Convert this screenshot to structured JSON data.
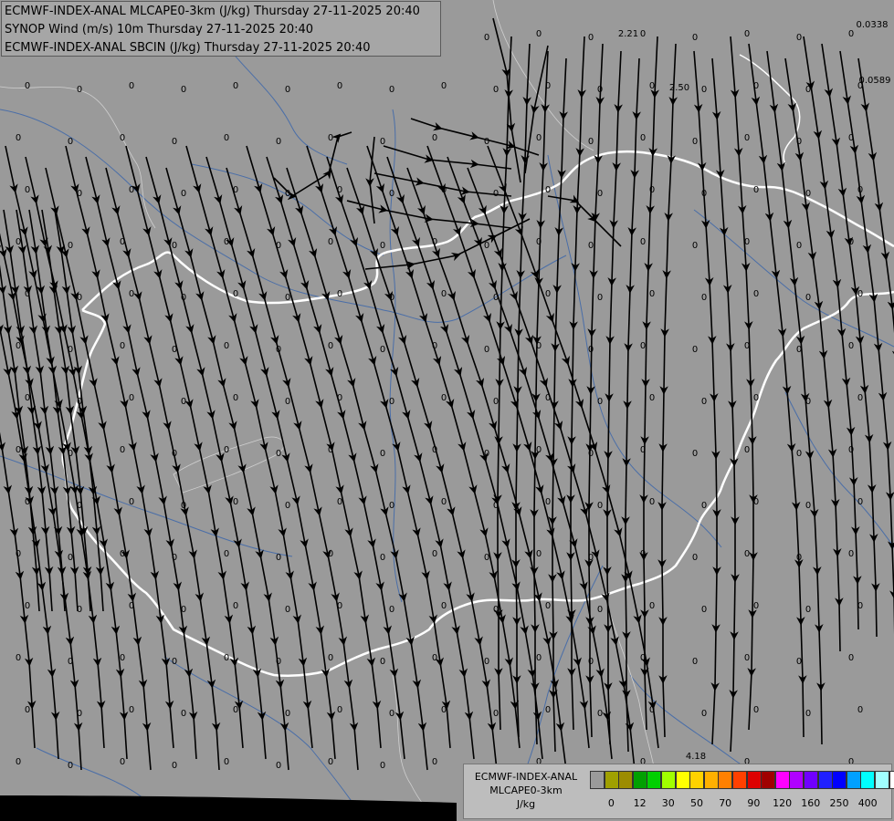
{
  "titles": [
    "ECMWF-INDEX-ANAL MLCAPE0-3km (J/kg) Thursday 27-11-2025 20:40",
    "SYNOP Wind (m/s) 10m Thursday 27-11-2025 20:40",
    "ECMWF-INDEX-ANAL SBCIN (J/kg) Thursday 27-11-2025 20:40"
  ],
  "legend": {
    "caption": [
      "ECMWF-INDEX-ANAL",
      "MLCAPE0-3km",
      "J/kg"
    ],
    "colors": [
      "#9a9a9a",
      "#a0a000",
      "#9c8c00",
      "#00a000",
      "#00d000",
      "#a0ff00",
      "#ffff00",
      "#ffd200",
      "#ffb000",
      "#ff8000",
      "#ff4000",
      "#dd0000",
      "#a00000",
      "#ff00ff",
      "#b000ff",
      "#7000ff",
      "#2020ff",
      "#0000ff",
      "#00a0ff",
      "#00ffff",
      "#a0ffff",
      "#ffffff"
    ],
    "ticks": [
      "0",
      "12",
      "30",
      "50",
      "70",
      "90",
      "120",
      "160",
      "250",
      "400"
    ]
  },
  "cape_values": {
    "grid_label": "0",
    "special": [
      "2.21",
      "2.50",
      "0.0338",
      "0.0589",
      "4.18"
    ]
  },
  "map": {
    "background": "#9a9a9a",
    "border_color": "#ffffff",
    "river_color": "#4a6ea8",
    "streamline_color": "#000000"
  }
}
